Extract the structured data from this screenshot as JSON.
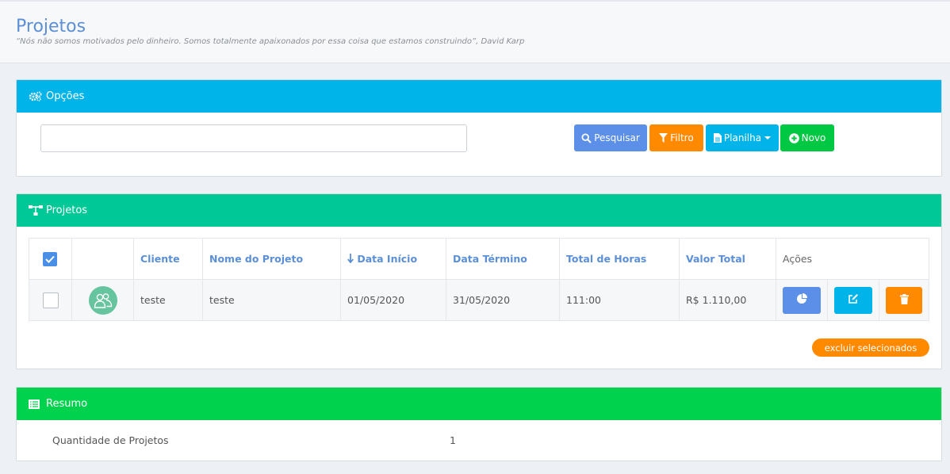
{
  "header": {
    "title": "Projetos",
    "quote": "“Nós não somos motivados pelo dinheiro. Somos totalmente apaixonados por essa coisa que estamos construindo”, David Karp"
  },
  "opcoes": {
    "title": "Opções",
    "search_value": "",
    "buttons": {
      "search": "Pesquisar",
      "filter": "Filtro",
      "sheet": "Planilha",
      "new": "Novo"
    }
  },
  "projetos": {
    "title": "Projetos",
    "columns": [
      "Cliente",
      "Nome do Projeto",
      "Data Início",
      "Data Término",
      "Total de Horas",
      "Valor Total",
      "Ações"
    ],
    "sort_column": "Data Início",
    "rows": [
      {
        "cliente": "teste",
        "nome": "teste",
        "inicio": "01/05/2020",
        "termino": "31/05/2020",
        "horas": "111:00",
        "valor": "R$ 1.110,00"
      }
    ],
    "delete_selected": "excluir selecionados"
  },
  "resumo": {
    "title": "Resumo",
    "label": "Quantidade de Projetos",
    "value": "1"
  },
  "colors": {
    "opcoes_header": "#00b3e8",
    "projetos_header": "#00c897",
    "resumo_header": "#00d24d",
    "primary": "#5b8fe8",
    "warning": "#ff8a00",
    "info": "#00b3e8",
    "success": "#00c842"
  }
}
